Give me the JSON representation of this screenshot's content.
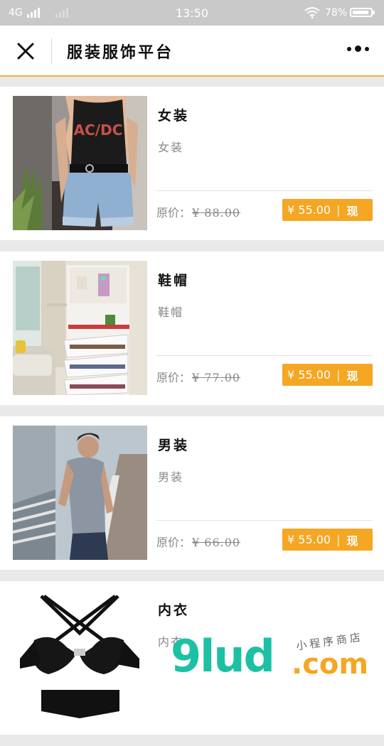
{
  "status_bar": {
    "network": "4G",
    "time": "13:50",
    "battery": "78%"
  },
  "header": {
    "title": "服装服饰平台"
  },
  "products": [
    {
      "name": "女装",
      "desc": "女装",
      "orig_label": "原价：",
      "orig_price": "¥ 88.00",
      "price": "¥ 55.00",
      "sep": "|",
      "action": "现"
    },
    {
      "name": "鞋帽",
      "desc": "鞋帽",
      "orig_label": "原价：",
      "orig_price": "¥ 77.00",
      "price": "¥ 55.00",
      "sep": "|",
      "action": "现"
    },
    {
      "name": "男装",
      "desc": "男装",
      "orig_label": "原价：",
      "orig_price": "¥ 66.00",
      "price": "¥ 55.00",
      "sep": "|",
      "action": "现"
    },
    {
      "name": "内衣",
      "desc": "内衣",
      "orig_label": "",
      "orig_price": "",
      "price": "",
      "sep": "",
      "action": ""
    }
  ],
  "watermark": {
    "brand": "9lud",
    "domain": ".com",
    "tagline": "小程序商店"
  },
  "colors": {
    "accent": "#f5a623",
    "header_border": "#f0b23c",
    "watermark_green": "#1ec0a3"
  }
}
